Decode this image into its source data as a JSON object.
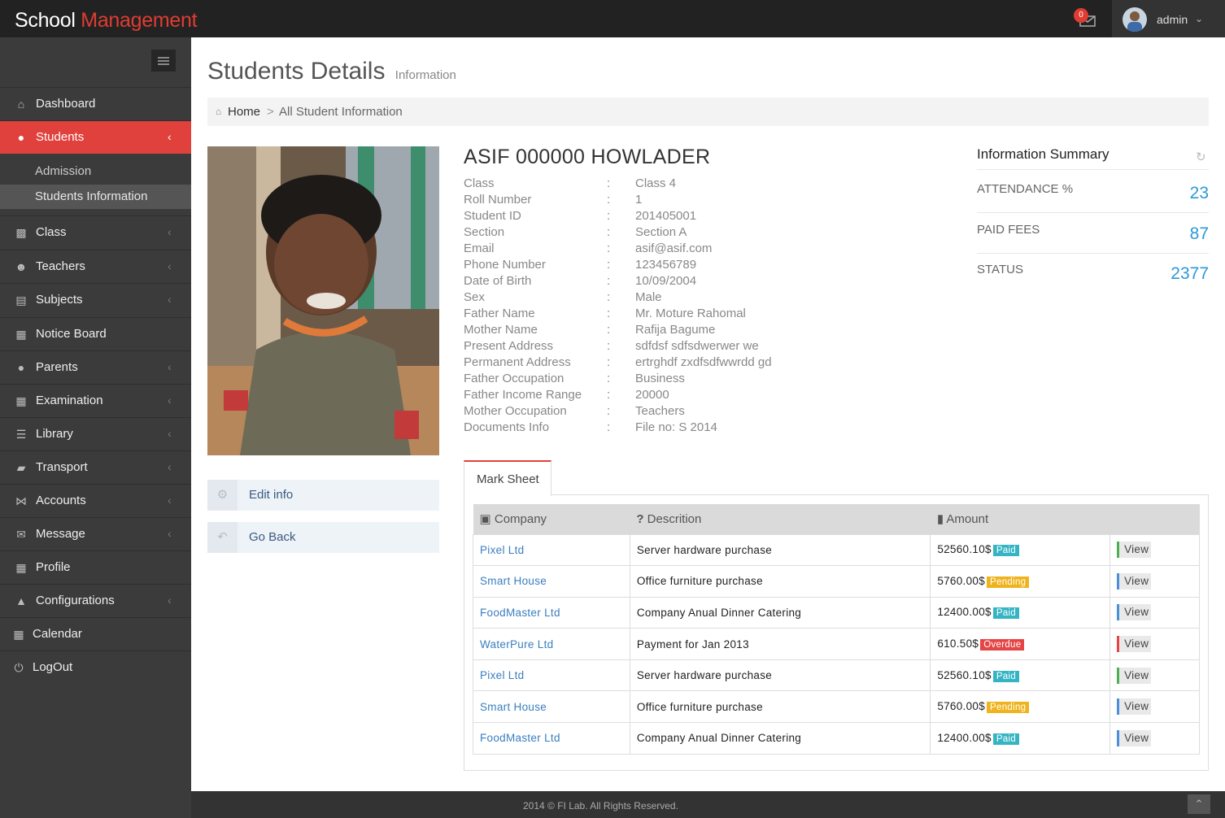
{
  "header": {
    "brand_part1": "School ",
    "brand_part2": "Management",
    "mail_count": "0",
    "username": "admin",
    "accent_color": "#e0413c"
  },
  "sidebar": {
    "items": [
      {
        "label": "Dashboard",
        "icon": "home-icon"
      },
      {
        "label": "Students",
        "icon": "users-icon"
      },
      {
        "label": "Class",
        "icon": "cubes-icon"
      },
      {
        "label": "Teachers",
        "icon": "user-group-icon"
      },
      {
        "label": "Subjects",
        "icon": "book-icon"
      },
      {
        "label": "Notice Board",
        "icon": "building-icon"
      },
      {
        "label": "Parents",
        "icon": "user-icon"
      },
      {
        "label": "Examination",
        "icon": "table-icon"
      },
      {
        "label": "Library",
        "icon": "list-icon"
      },
      {
        "label": "Transport",
        "icon": "truck-icon"
      },
      {
        "label": "Accounts",
        "icon": "share-icon"
      },
      {
        "label": "Message",
        "icon": "envelope-open-icon"
      },
      {
        "label": "Profile",
        "icon": "grid-icon"
      },
      {
        "label": "Configurations",
        "icon": "graduation-cap-icon"
      },
      {
        "label": "Calendar",
        "icon": "calendar-icon"
      },
      {
        "label": "LogOut",
        "icon": "power-icon"
      }
    ],
    "sub_items": [
      "Admission",
      "Students Information"
    ]
  },
  "page": {
    "title": "Students Details",
    "subtitle": "Information"
  },
  "breadcrumb": {
    "home": "Home",
    "separator": ">",
    "current": "All Student Information"
  },
  "actions": {
    "edit": "Edit info",
    "back": "Go Back"
  },
  "student": {
    "name": "ASIF 000000 HOWLADER",
    "details": [
      {
        "key": "Class",
        "value": "Class 4"
      },
      {
        "key": "Roll Number",
        "value": "1"
      },
      {
        "key": "Student ID",
        "value": "201405001"
      },
      {
        "key": "Section",
        "value": "Section A"
      },
      {
        "key": "Email",
        "value": "asif@asif.com"
      },
      {
        "key": "Phone Number",
        "value": "123456789"
      },
      {
        "key": "Date of Birth",
        "value": "10/09/2004"
      },
      {
        "key": "Sex",
        "value": "Male"
      },
      {
        "key": "Father Name",
        "value": "Mr. Moture Rahomal"
      },
      {
        "key": "Mother Name",
        "value": "Rafija Bagume"
      },
      {
        "key": "Present Address",
        "value": "sdfdsf sdfsdwerwer we"
      },
      {
        "key": "Permanent Address",
        "value": "ertrghdf zxdfsdfwwrdd gd"
      },
      {
        "key": "Father Occupation",
        "value": "Business"
      },
      {
        "key": "Father Income Range",
        "value": "20000"
      },
      {
        "key": "Mother Occupation",
        "value": "Teachers"
      },
      {
        "key": "Documents Info",
        "value": "File no: S 2014"
      }
    ],
    "colon": ":"
  },
  "summary": {
    "title": "Information Summary",
    "rows": [
      {
        "label": "ATTENDANCE %",
        "value": "23"
      },
      {
        "label": "PAID FEES",
        "value": "87"
      },
      {
        "label": "STATUS",
        "value": "2377"
      }
    ]
  },
  "marksheet": {
    "tab_label": "Mark Sheet",
    "headers": [
      "Company",
      "Descrition",
      "Amount"
    ],
    "view_label": "View",
    "rows": [
      {
        "company": "Pixel Ltd",
        "description": "Server hardware purchase",
        "amount": "52560.10$",
        "status": "Paid",
        "status_color": "#35b5c4",
        "view_color": "#4caf50"
      },
      {
        "company": "Smart House",
        "description": "Office furniture purchase",
        "amount": "5760.00$",
        "status": "Pending",
        "status_color": "#efb31d",
        "view_color": "#4a90d9"
      },
      {
        "company": "FoodMaster Ltd",
        "description": "Company Anual Dinner Catering",
        "amount": "12400.00$",
        "status": "Paid",
        "status_color": "#35b5c4",
        "view_color": "#4a90d9"
      },
      {
        "company": "WaterPure Ltd",
        "description": "Payment for Jan 2013",
        "amount": "610.50$",
        "status": "Overdue",
        "status_color": "#e64545",
        "view_color": "#e64545"
      },
      {
        "company": "Pixel Ltd",
        "description": "Server hardware purchase",
        "amount": "52560.10$",
        "status": "Paid",
        "status_color": "#35b5c4",
        "view_color": "#4caf50"
      },
      {
        "company": "Smart House",
        "description": "Office furniture purchase",
        "amount": "5760.00$",
        "status": "Pending",
        "status_color": "#efb31d",
        "view_color": "#4a90d9"
      },
      {
        "company": "FoodMaster Ltd",
        "description": "Company Anual Dinner Catering",
        "amount": "12400.00$",
        "status": "Paid",
        "status_color": "#35b5c4",
        "view_color": "#4a90d9"
      }
    ]
  },
  "footer": {
    "text": "2014 © FI Lab. All Rights Reserved."
  }
}
